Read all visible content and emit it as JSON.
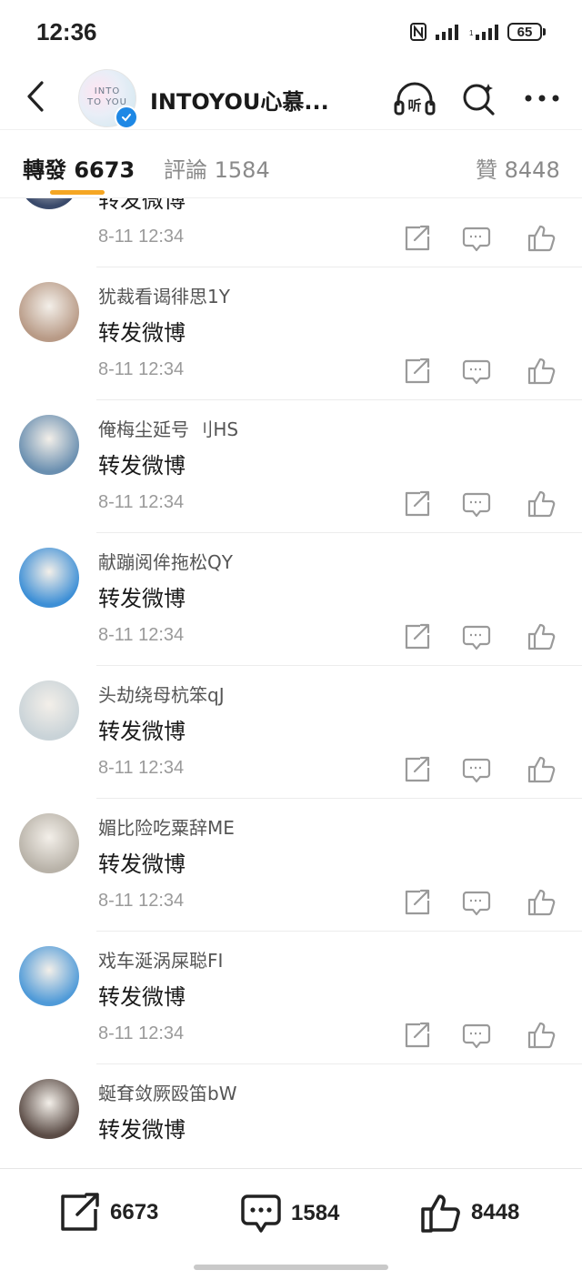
{
  "status_bar": {
    "time": "12:36",
    "battery": "65"
  },
  "header": {
    "title": "INTOYOU心慕...",
    "avatar_text_top": "INTO",
    "avatar_text_bottom": "TO YOU"
  },
  "tabs": [
    {
      "label": "轉發",
      "count": "6673"
    },
    {
      "label": "評論",
      "count": "1584"
    },
    {
      "label": "贊",
      "count": "8448"
    }
  ],
  "reposts": [
    {
      "user": "",
      "content": "转发微博",
      "time": "8-11 12:34",
      "avatar_color": "#3a4a6b"
    },
    {
      "user": "犹裁看谒徘思1Y",
      "content": "转发微博",
      "time": "8-11 12:34",
      "avatar_color": "#b89a86"
    },
    {
      "user": "俺梅尘延号 刂HS",
      "content": "转发微博",
      "time": "8-11 12:34",
      "avatar_color": "#6a8fb0"
    },
    {
      "user": "献蹦阅侔拖松QY",
      "content": "转发微博",
      "time": "8-11 12:34",
      "avatar_color": "#3d8fd6"
    },
    {
      "user": "头劫绕母杭笨qJ",
      "content": "转发微博",
      "time": "8-11 12:34",
      "avatar_color": "#c9d3d8"
    },
    {
      "user": "媚比险吃粟辞ME",
      "content": "转发微博",
      "time": "8-11 12:34",
      "avatar_color": "#b8b2a8"
    },
    {
      "user": "戏车涎涡屎聪FI",
      "content": "转发微博",
      "time": "8-11 12:34",
      "avatar_color": "#4f9ad8"
    },
    {
      "user": "蜒耷敛厥殴笛bW",
      "content": "转发微博",
      "time": "",
      "avatar_color": "#5a4b45"
    }
  ],
  "bottom_bar": {
    "repost_count": "6673",
    "comment_count": "1584",
    "like_count": "8448"
  },
  "colors": {
    "accent": "#f5a623",
    "verified": "#1e88e5"
  }
}
